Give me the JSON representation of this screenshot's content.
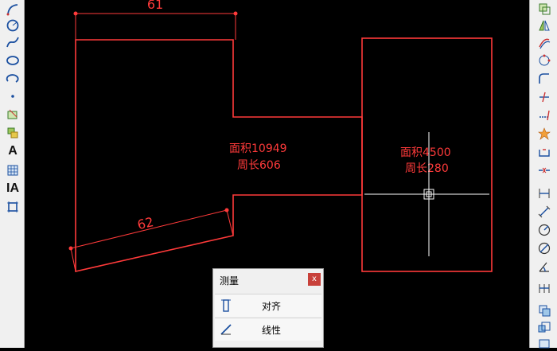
{
  "drawing": {
    "left_shape": {
      "area_label": "面积10949",
      "perimeter_label": "周长606"
    },
    "right_shape": {
      "area_label": "面积4500",
      "perimeter_label": "周长280"
    },
    "dimensions": {
      "top_width": "61",
      "bottom_slant": "62"
    },
    "colors": {
      "background": "#000000",
      "geometry": "#ff3a3a",
      "crosshair": "#ffffff"
    }
  },
  "measure_panel": {
    "title": "测量",
    "close_label": "x",
    "items": [
      {
        "label": "对齐",
        "icon": "aligned-dimension-icon"
      },
      {
        "label": "线性",
        "icon": "linear-dimension-icon"
      }
    ]
  },
  "left_toolbar": {
    "text_tool": "A",
    "multiline_text_tool": "IA"
  }
}
